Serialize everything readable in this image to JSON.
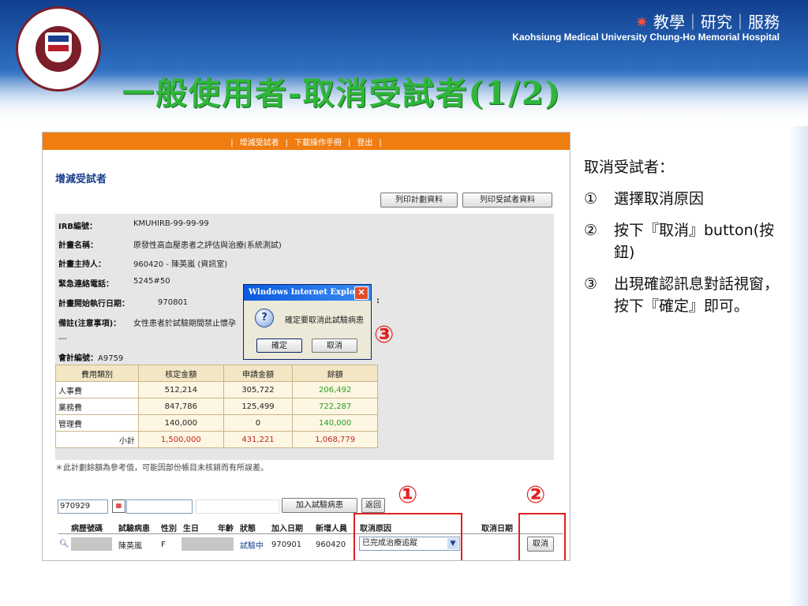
{
  "header": {
    "tagline_star": "✷",
    "tagline": "教學｜研究｜服務",
    "subtitle": "Kaohsiung Medical University  Chung-Ho Memorial Hospital"
  },
  "slide_title": "一般使用者-取消受試者(1/2)",
  "notes": {
    "heading": "取消受試者：",
    "items": [
      {
        "num": "①",
        "text": "選擇取消原因"
      },
      {
        "num": "②",
        "text": "按下『取消』button(按鈕)"
      },
      {
        "num": "③",
        "text": "出現確認訊息對話視窗，按下『確定』即可。"
      }
    ]
  },
  "app": {
    "nav": [
      "增減受試者",
      "下載操作手冊",
      "登出"
    ],
    "section_title": "增減受試者",
    "print_plan_btn": "列印計劃資料",
    "print_subject_btn": "列印受試者資料",
    "fields": {
      "irb_label": "IRB編號：",
      "irb_value": "KMUHIRB-99-99-99",
      "plan_label": "計畫名稱：",
      "plan_value": "原發性高血壓患者之評估與治療(系統測試)",
      "pi_label": "計畫主持人：",
      "pi_value": "960420 - 陳英嵐 (資訊室)",
      "phone_label": "緊急連絡電話：",
      "phone_value": "5245#50",
      "start_label": "計畫開始執行日期：",
      "start_value": "970801",
      "remark_label": "備註(注意事項)：",
      "remark_value": "女性患者於試驗期間禁止懷孕",
      "dash": "---",
      "account_label": "會計編號：",
      "account_value": "A9759"
    },
    "budget": {
      "headers": [
        "費用類別",
        "核定金額",
        "申請金額",
        "餘額"
      ],
      "rows": [
        {
          "cat": "人事費",
          "approved": "512,214",
          "applied": "305,722",
          "balance": "206,492"
        },
        {
          "cat": "業務費",
          "approved": "847,786",
          "applied": "125,499",
          "balance": "722,287"
        },
        {
          "cat": "管理費",
          "approved": "140,000",
          "applied": "0",
          "balance": "140,000"
        }
      ],
      "subtotal_label": "小計",
      "subtotal": {
        "approved": "1,500,000",
        "applied": "431,221",
        "balance": "1,068,779"
      }
    },
    "note_line": "＊此計劃餘額為參考值，可能因部份帳目未核銷而有所誤差。",
    "dialog": {
      "title": "Windows Internet Explorer",
      "message": "確定要取消此試驗病患",
      "ok": "確定",
      "cancel": "取消",
      "close": "✕",
      "icon": "?"
    },
    "search": {
      "date_value": "970929",
      "add_button": "加入試驗病患",
      "back_button": "返回"
    },
    "list_headers": [
      "病歷號碼",
      "試驗病患",
      "性別",
      "生日",
      "年齡",
      "狀態",
      "加入日期",
      "新增人員",
      "取消原因",
      "取消日期"
    ],
    "list_row": {
      "name": "陳英嵐",
      "gender": "F",
      "status": "試驗中",
      "join_date": "970901",
      "added_by": "960420",
      "reason": "已完成治療追蹤",
      "cancel_btn": "取消"
    }
  },
  "annotations": {
    "c1": "①",
    "c2": "②",
    "c3": "③"
  },
  "colors": {
    "title_green": "#2fb63a",
    "orange_bar": "#f07d10",
    "highlight_red": "#e02020"
  }
}
